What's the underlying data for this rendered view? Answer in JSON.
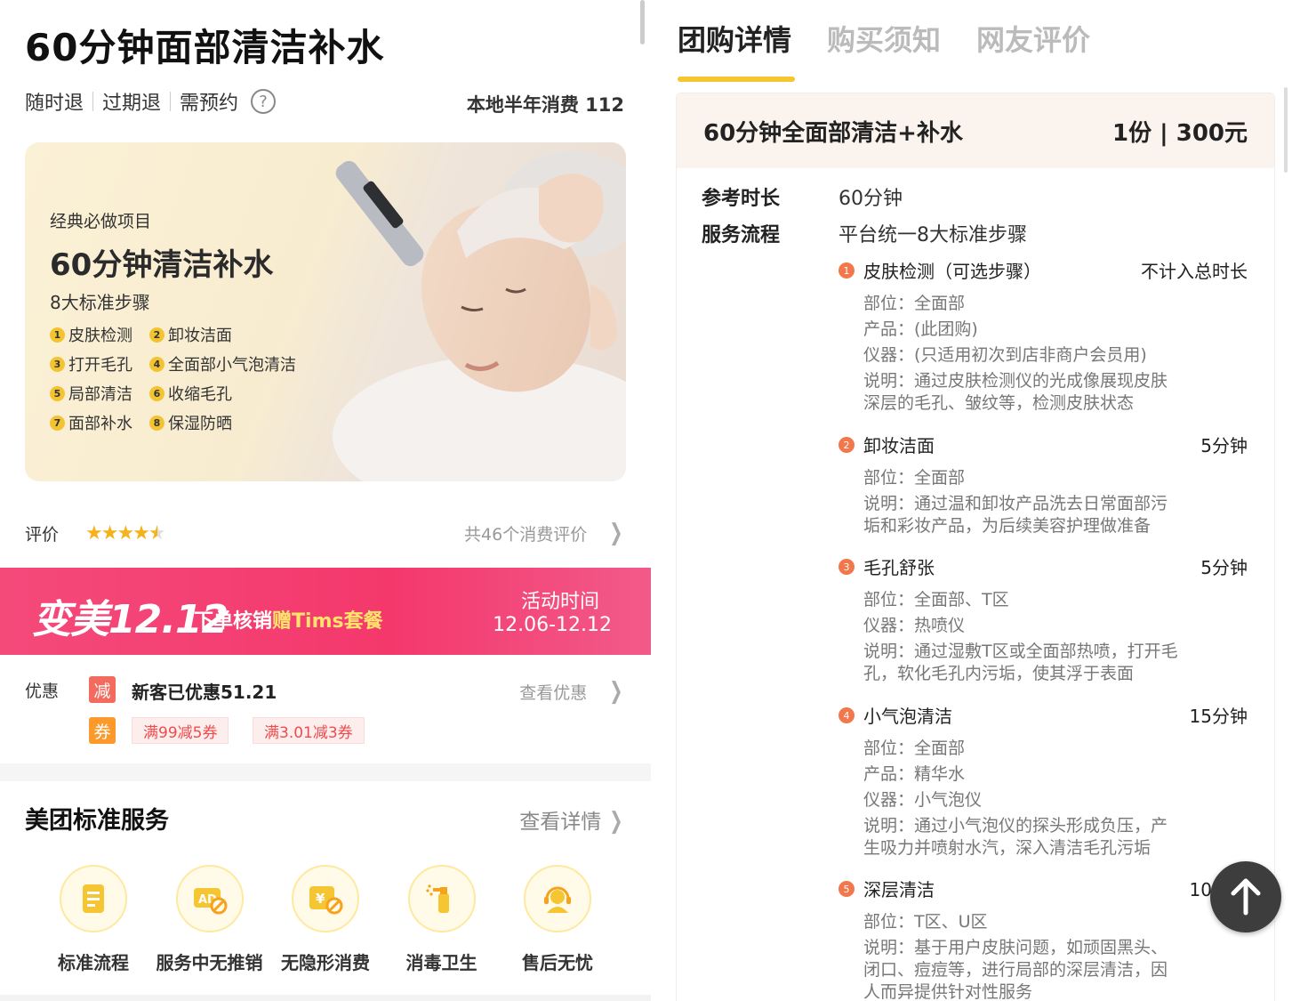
{
  "left": {
    "title": "60分钟面部清洁补水",
    "tags": [
      "随时退",
      "过期退",
      "需预约"
    ],
    "local_sales": "本地半年消费 112",
    "banner": {
      "kicker": "经典必做项目",
      "headline": "60分钟清洁补水",
      "subtitle": "8大标准步骤",
      "steps": [
        {
          "num": "1",
          "label": "皮肤检测"
        },
        {
          "num": "2",
          "label": "卸妆洁面"
        },
        {
          "num": "3",
          "label": "打开毛孔"
        },
        {
          "num": "4",
          "label": "全面部小气泡清洁"
        },
        {
          "num": "5",
          "label": "局部清洁"
        },
        {
          "num": "6",
          "label": "收缩毛孔"
        },
        {
          "num": "7",
          "label": "面部补水"
        },
        {
          "num": "8",
          "label": "保湿防晒"
        }
      ]
    },
    "rating": {
      "label": "评价",
      "stars": 4.5,
      "count_text": "共46个消费评价"
    },
    "promo": {
      "big_text": "变美12.12",
      "small_text_a": "下单核销",
      "small_text_b": "赠Tims套餐",
      "time_label": "活动时间",
      "time_value": "12.06-12.12",
      "color": "#f4386c"
    },
    "discount": {
      "label": "优惠",
      "badge_reduce": "减",
      "new_user_text": "新客已优惠51.21",
      "view_link": "查看优惠",
      "badge_coupon": "券",
      "coupons": [
        "满99减5券",
        "满3.01减3券"
      ]
    },
    "standard": {
      "title": "美团标准服务",
      "link": "查看详情",
      "items": [
        {
          "label": "标准流程",
          "icon": "document-icon"
        },
        {
          "label": "服务中无推销",
          "icon": "no-ad-icon"
        },
        {
          "label": "无隐形消费",
          "icon": "no-hidden-fee-icon"
        },
        {
          "label": "消毒卫生",
          "icon": "spray-icon"
        },
        {
          "label": "售后无忧",
          "icon": "support-agent-icon"
        }
      ]
    }
  },
  "right": {
    "tabs": [
      "团购详情",
      "购买须知",
      "网友评价"
    ],
    "active_tab": 0,
    "card": {
      "name": "60分钟全面部清洁+补水",
      "price": "1份 | 300元",
      "ref_duration_label": "参考时长",
      "ref_duration_value": "60分钟",
      "process_label": "服务流程",
      "process_value": "平台统一8大标准步骤",
      "steps": [
        {
          "num": "1",
          "name": "皮肤检测（可选步骤）",
          "duration": "不计入总时长",
          "lines": [
            "部位：全面部",
            "产品：(此团购)",
            "仪器：(只适用初次到店非商户会员用)",
            "说明：通过皮肤检测仪的光成像展现皮肤",
            "深层的毛孔、皱纹等，检测皮肤状态"
          ]
        },
        {
          "num": "2",
          "name": "卸妆洁面",
          "duration": "5分钟",
          "lines": [
            "部位：全面部",
            "说明：通过温和卸妆产品洗去日常面部污",
            "垢和彩妆产品，为后续美容护理做准备"
          ]
        },
        {
          "num": "3",
          "name": "毛孔舒张",
          "duration": "5分钟",
          "lines": [
            "部位：全面部、T区",
            "仪器：热喷仪",
            "说明：通过湿敷T区或全面部热喷，打开毛",
            "孔，软化毛孔内污垢，使其浮于表面"
          ]
        },
        {
          "num": "4",
          "name": "小气泡清洁",
          "duration": "15分钟",
          "lines": [
            "部位：全面部",
            "产品：精华水",
            "仪器：小气泡仪",
            "说明：通过小气泡仪的探头形成负压，产",
            "生吸力并喷射水汽，深入清洁毛孔污垢"
          ]
        },
        {
          "num": "5",
          "name": "深层清洁",
          "duration": "10分钟",
          "lines": [
            "部位：T区、U区",
            "说明：基于用户皮肤问题，如顽固黑头、",
            "闭口、痘痘等，进行局部的深层清洁，因",
            "人而异提供针对性服务"
          ]
        }
      ]
    }
  },
  "colors": {
    "accent_yellow": "#f6c532",
    "promo_pink": "#f4386c",
    "step_orange": "#f2784b",
    "star": "#f6b21b"
  }
}
